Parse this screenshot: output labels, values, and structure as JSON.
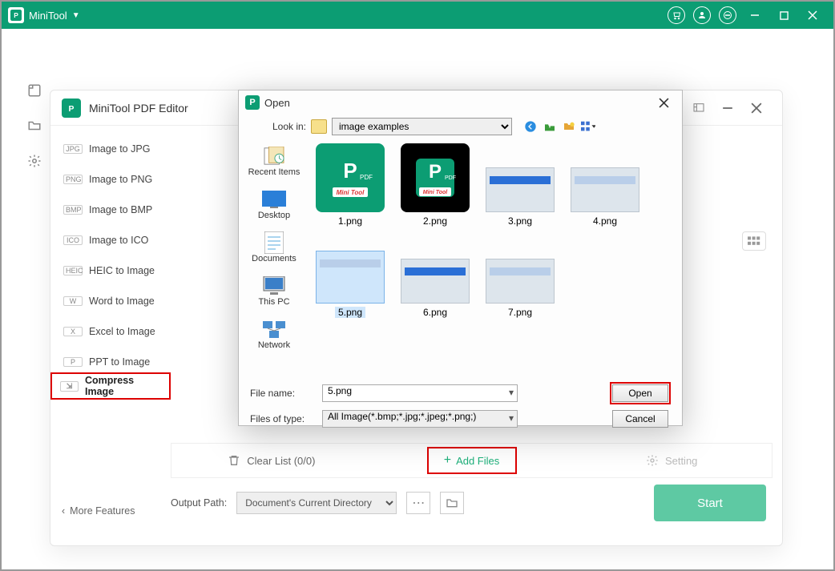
{
  "app": {
    "name": "MiniTool"
  },
  "inner": {
    "title": "MiniTool PDF Editor",
    "side_items": [
      {
        "badge": "JPG",
        "label": "Image to JPG"
      },
      {
        "badge": "PNG",
        "label": "Image to PNG"
      },
      {
        "badge": "BMP",
        "label": "Image to BMP"
      },
      {
        "badge": "ICO",
        "label": "Image to ICO"
      },
      {
        "badge": "HEIC",
        "label": "HEIC to Image"
      },
      {
        "badge": "W",
        "label": "Word to Image"
      },
      {
        "badge": "X",
        "label": "Excel to Image"
      },
      {
        "badge": "P",
        "label": "PPT to Image"
      },
      {
        "badge": "⇲",
        "label": "Compress Image"
      }
    ],
    "more_features": "More Features",
    "clear_list": "Clear List (0/0)",
    "add_files": "Add Files",
    "setting": "Setting",
    "output_path_label": "Output Path:",
    "output_path_value": "Document's Current Directory",
    "start": "Start"
  },
  "dialog": {
    "title": "Open",
    "look_in_label": "Look in:",
    "look_in_value": "image examples",
    "sidebar": [
      "Recent Items",
      "Desktop",
      "Documents",
      "This PC",
      "Network"
    ],
    "files": [
      {
        "name": "1.png",
        "kind": "logo"
      },
      {
        "name": "2.png",
        "kind": "logo"
      },
      {
        "name": "3.png",
        "kind": "shot"
      },
      {
        "name": "4.png",
        "kind": "shot-light"
      },
      {
        "name": "5.png",
        "kind": "shot-light",
        "selected": true
      },
      {
        "name": "6.png",
        "kind": "shot"
      },
      {
        "name": "7.png",
        "kind": "shot"
      }
    ],
    "file_name_label": "File name:",
    "file_name_value": "5.png",
    "file_type_label": "Files of type:",
    "file_type_value": "All Image(*.bmp;*.jpg;*.jpeg;*.png;)",
    "open_btn": "Open",
    "cancel_btn": "Cancel"
  }
}
